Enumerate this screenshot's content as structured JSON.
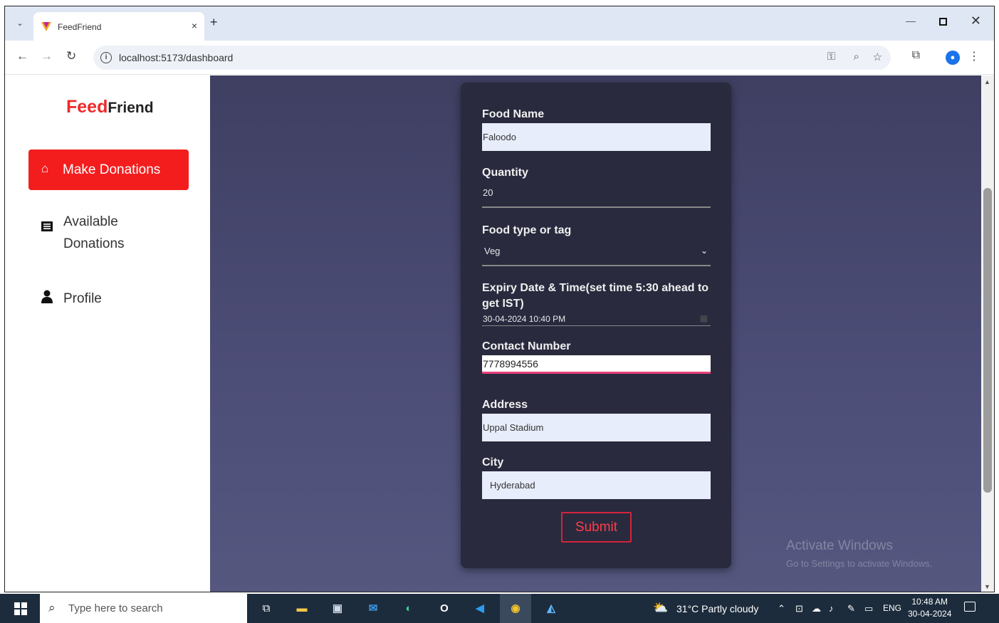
{
  "browser": {
    "tab_title": "FeedFriend",
    "tab_close": "×",
    "new_tab": "+",
    "url": "localhost:5173/dashboard"
  },
  "sidebar": {
    "logo_feed": "Feed",
    "logo_friend": "Friend",
    "items": [
      {
        "label": "Make Donations",
        "icon": "home-icon"
      },
      {
        "label": "Available Donations",
        "icon": "list-icon"
      },
      {
        "label": "Profile",
        "icon": "user-icon"
      }
    ]
  },
  "form": {
    "food_name": {
      "label": "Food Name",
      "value": "Faloodo"
    },
    "quantity": {
      "label": "Quantity",
      "value": "20"
    },
    "food_type": {
      "label": "Food type or tag",
      "value": "Veg"
    },
    "expiry": {
      "label": "Expiry Date & Time(set time 5:30 ahead to get IST)",
      "value": "30-04-2024 10:40 PM"
    },
    "contact": {
      "label": "Contact Number",
      "value": "7778994556"
    },
    "address": {
      "label": "Address",
      "value": "Uppal Stadium"
    },
    "city": {
      "label": "City",
      "value": "Hyderabad"
    },
    "submit_label": "Submit"
  },
  "watermark": {
    "line1": "Activate Windows",
    "line2": "Go to Settings to activate Windows."
  },
  "taskbar": {
    "search_placeholder": "Type here to search",
    "weather": "31°C  Partly cloudy",
    "lang": "ENG",
    "time": "10:48 AM",
    "date": "30-04-2024"
  },
  "colors": {
    "brand_red": "#f41d1d",
    "card_bg": "#292a3e",
    "main_bg": "#4d4e78",
    "submit_red": "#d6233a"
  }
}
